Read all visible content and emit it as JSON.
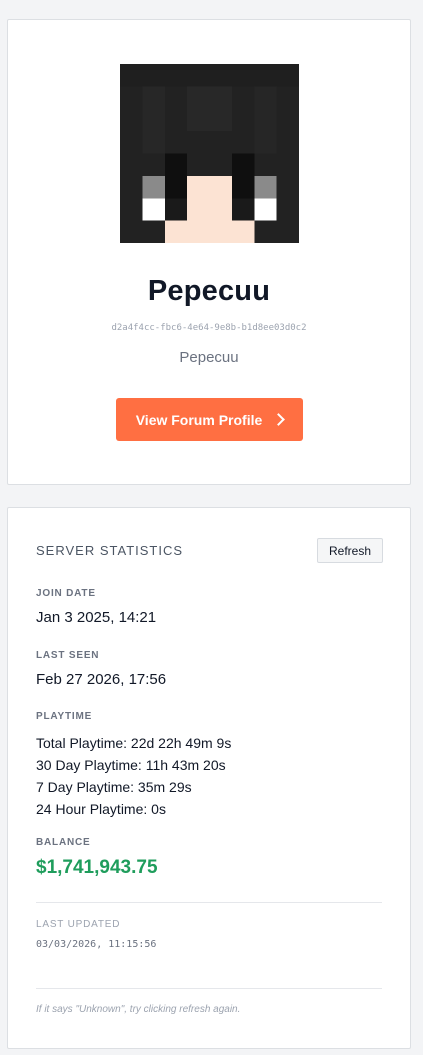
{
  "profile": {
    "username": "Pepecuu",
    "uuid": "d2a4f4cc-fbc6-4e64-9e8b-b1d8ee03d0c2",
    "display_name": "Pepecuu",
    "forum_button_label": "View Forum Profile",
    "forum_button_icon": "chevron-right-icon",
    "accent_color": "#ff6f42"
  },
  "stats": {
    "title": "SERVER STATISTICS",
    "refresh_label": "Refresh",
    "join_date_label": "JOIN DATE",
    "join_date": "Jan 3 2025, 14:21",
    "last_seen_label": "LAST SEEN",
    "last_seen": "Feb 27 2026, 17:56",
    "playtime_label": "PLAYTIME",
    "playtime_lines": [
      "Total Playtime: 22d 22h 49m 9s",
      "30 Day Playtime: 11h 43m 20s",
      "7 Day Playtime: 35m 29s",
      "24 Hour Playtime: 0s"
    ],
    "balance_label": "BALANCE",
    "balance": "$1,741,943.75",
    "balance_color": "#1f9d5c",
    "last_updated_label": "LAST UPDATED",
    "last_updated": "03/03/2026, 11:15:56",
    "hint": "If it says \"Unknown\", try clicking refresh again."
  }
}
